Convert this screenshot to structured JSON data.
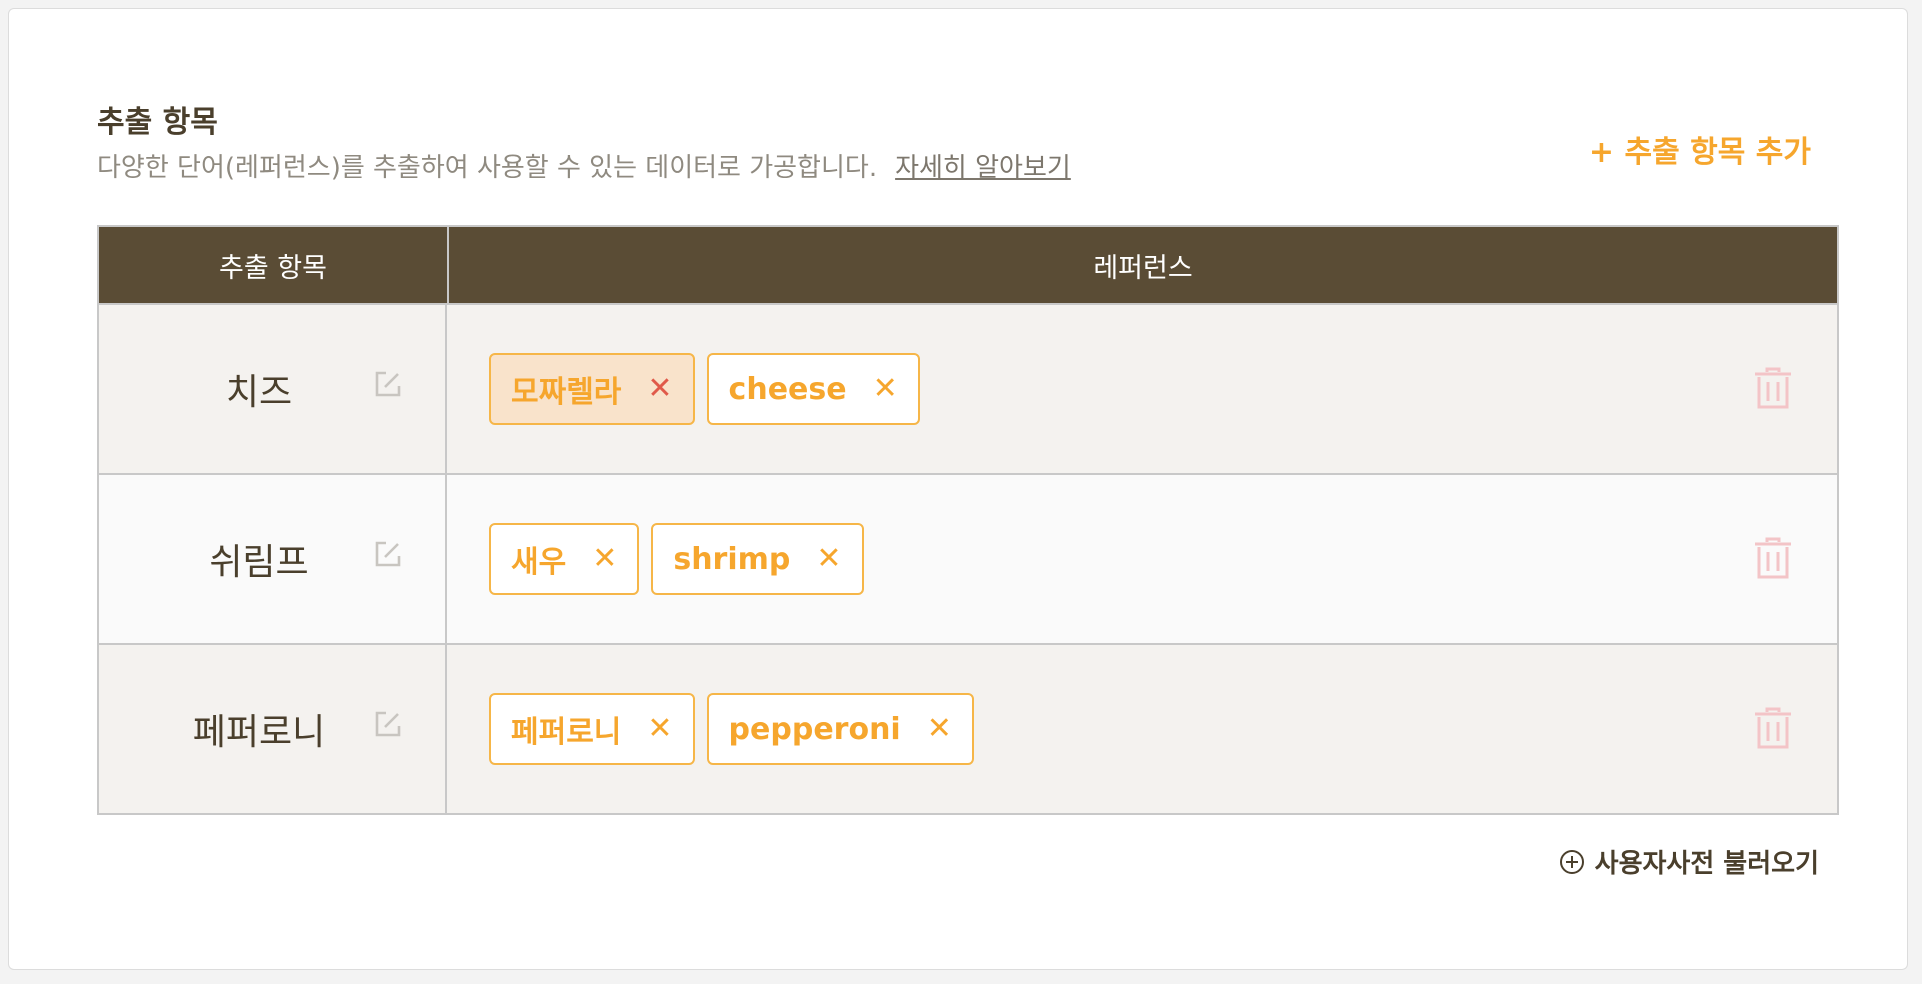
{
  "section": {
    "title": "추출 항목",
    "description": "다양한 단어(레퍼런스)를 추출하여 사용할 수 있는 데이터로 가공합니다.",
    "learn_more": "자세히 알아보기",
    "add_button": "+ 추출 항목 추가"
  },
  "table": {
    "headers": [
      "추출 항목",
      "레퍼런스"
    ],
    "rows": [
      {
        "name": "치즈",
        "tags": [
          "모짜렐라",
          "cheese"
        ],
        "selected_tag": "모짜렐라"
      },
      {
        "name": "쉬림프",
        "tags": [
          "새우",
          "shrimp"
        ]
      },
      {
        "name": "페퍼로니",
        "tags": [
          "페퍼로니",
          "pepperoni"
        ]
      }
    ]
  },
  "footer": {
    "user_dict_button": "사용자사전 불러오기"
  },
  "icons": {
    "edit": "edit-icon",
    "remove": "close-icon",
    "delete": "trash-icon",
    "add": "plus-circle-icon"
  },
  "colors": {
    "accent": "#f6a62d",
    "header_bg": "#5a4c35",
    "selected_tag_bg": "#f9e3cb",
    "selected_remove": "#e05a4a",
    "trash": "#f3c4c7"
  }
}
